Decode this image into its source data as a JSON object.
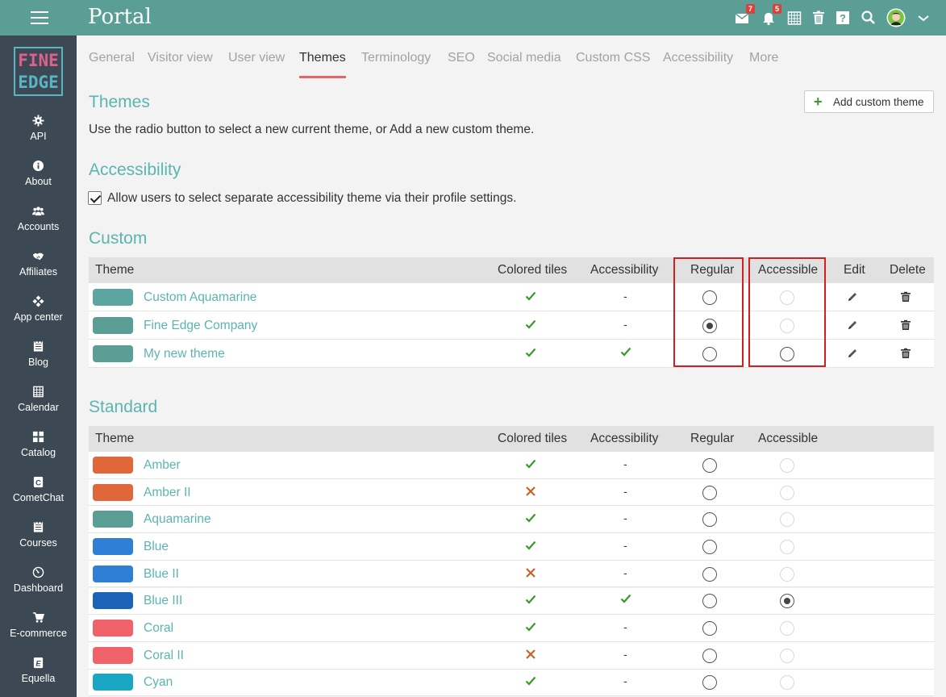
{
  "app": {
    "title": "Portal"
  },
  "topbar": {
    "mail_badge": "7",
    "bell_badge": "5",
    "icons": [
      "mail-icon",
      "bell-icon",
      "calendar-grid-icon",
      "trash-icon",
      "help-icon",
      "search-icon",
      "avatar",
      "chevron-down-icon"
    ]
  },
  "logo": {
    "line1": "FINE",
    "line2": "EDGE"
  },
  "sidebar": {
    "items": [
      {
        "label": "API",
        "icon": "gear-icon"
      },
      {
        "label": "About",
        "icon": "info-icon"
      },
      {
        "label": "Accounts",
        "icon": "users-icon"
      },
      {
        "label": "Affiliates",
        "icon": "handshake-icon"
      },
      {
        "label": "App center",
        "icon": "apps-icon"
      },
      {
        "label": "Blog",
        "icon": "blog-icon"
      },
      {
        "label": "Calendar",
        "icon": "calendar-icon"
      },
      {
        "label": "Catalog",
        "icon": "catalog-icon"
      },
      {
        "label": "CometChat",
        "icon": "chat-icon"
      },
      {
        "label": "Courses",
        "icon": "courses-icon"
      },
      {
        "label": "Dashboard",
        "icon": "dashboard-icon"
      },
      {
        "label": "E-commerce",
        "icon": "cart-icon"
      },
      {
        "label": "Equella",
        "icon": "equella-icon"
      }
    ]
  },
  "tabs": [
    "General",
    "Visitor view",
    "User view",
    "Themes",
    "Terminology",
    "SEO",
    "Social media",
    "Custom CSS",
    "Accessibility",
    "More"
  ],
  "active_tab": "Themes",
  "themes_section": {
    "title": "Themes",
    "description": "Use the radio button to select a new current theme, or Add a new custom theme.",
    "add_button": "Add custom theme"
  },
  "accessibility_section": {
    "title": "Accessibility",
    "checkbox_label": "Allow users to select separate accessibility theme via their profile settings.",
    "checked": true
  },
  "custom_section": {
    "title": "Custom",
    "headers": {
      "theme": "Theme",
      "colored": "Colored tiles",
      "accessibility": "Accessibility",
      "regular": "Regular",
      "accessible": "Accessible",
      "edit": "Edit",
      "delete": "Delete"
    },
    "rows": [
      {
        "name": "Custom Aquamarine",
        "color": "#5da5a1",
        "colored": "check",
        "accessibility": "-",
        "regular": false,
        "accessible": "disabled"
      },
      {
        "name": "Fine Edge Company",
        "color": "#5a9e96",
        "colored": "check",
        "accessibility": "-",
        "regular": true,
        "accessible": "disabled"
      },
      {
        "name": "My new theme",
        "color": "#5a9e96",
        "colored": "check",
        "accessibility": "check",
        "regular": false,
        "accessible": "enabled"
      }
    ]
  },
  "standard_section": {
    "title": "Standard",
    "headers": {
      "theme": "Theme",
      "colored": "Colored tiles",
      "accessibility": "Accessibility",
      "regular": "Regular",
      "accessible": "Accessible"
    },
    "rows": [
      {
        "name": "Amber",
        "color": "#e0673a",
        "colored": "check",
        "accessibility": "-",
        "regular": false,
        "accessible": "disabled"
      },
      {
        "name": "Amber II",
        "color": "#e0673a",
        "colored": "cross",
        "accessibility": "-",
        "regular": false,
        "accessible": "disabled"
      },
      {
        "name": "Aquamarine",
        "color": "#5a9e96",
        "colored": "check",
        "accessibility": "-",
        "regular": false,
        "accessible": "disabled"
      },
      {
        "name": "Blue",
        "color": "#2f7fd6",
        "colored": "check",
        "accessibility": "-",
        "regular": false,
        "accessible": "disabled"
      },
      {
        "name": "Blue II",
        "color": "#2f7fd6",
        "colored": "cross",
        "accessibility": "-",
        "regular": false,
        "accessible": "disabled"
      },
      {
        "name": "Blue III",
        "color": "#1c63b8",
        "colored": "check",
        "accessibility": "check",
        "regular": false,
        "accessible": "checked"
      },
      {
        "name": "Coral",
        "color": "#f0636b",
        "colored": "check",
        "accessibility": "-",
        "regular": false,
        "accessible": "disabled"
      },
      {
        "name": "Coral II",
        "color": "#f0636b",
        "colored": "cross",
        "accessibility": "-",
        "regular": false,
        "accessible": "disabled"
      },
      {
        "name": "Cyan",
        "color": "#1aa7c4",
        "colored": "check",
        "accessibility": "-",
        "regular": false,
        "accessible": "disabled"
      }
    ]
  },
  "colors": {
    "accent": "#5ab5b0",
    "topbar": "#5a9e96",
    "sidebar": "#3c4854",
    "highlight": "#d11f1f",
    "check": "#3a9a2a",
    "cross": "#c9612a"
  }
}
